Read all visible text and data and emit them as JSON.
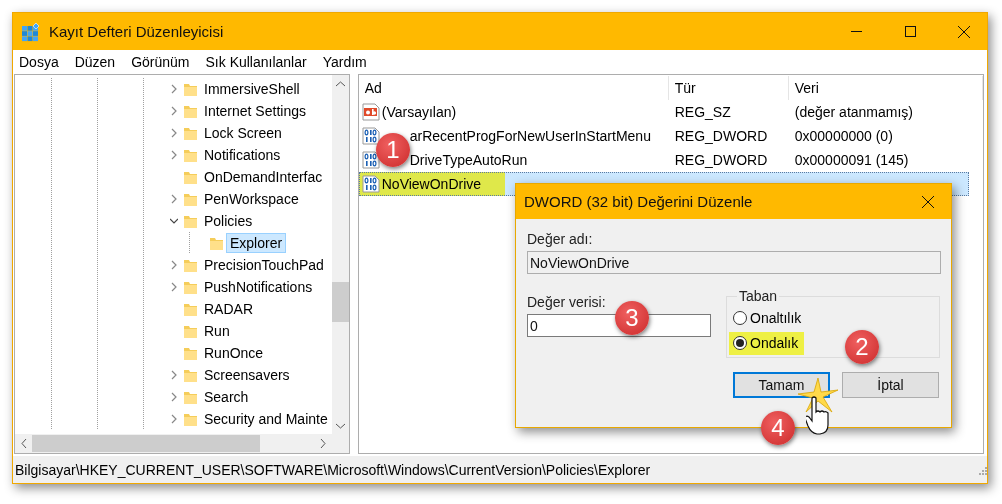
{
  "window": {
    "title": "Kayıt Defteri Düzenleyicisi"
  },
  "menu": [
    "Dosya",
    "Düzen",
    "Görünüm",
    "Sık Kullanılanlar",
    "Yardım"
  ],
  "tree": {
    "items": [
      {
        "label": "ImmersiveShell",
        "expandable": true,
        "expanded": false,
        "selected": false
      },
      {
        "label": "Internet Settings",
        "expandable": true,
        "expanded": false,
        "selected": false
      },
      {
        "label": "Lock Screen",
        "expandable": true,
        "expanded": false,
        "selected": false
      },
      {
        "label": "Notifications",
        "expandable": true,
        "expanded": false,
        "selected": false
      },
      {
        "label": "OnDemandInterfac",
        "expandable": false,
        "selected": false
      },
      {
        "label": "PenWorkspace",
        "expandable": true,
        "expanded": false,
        "selected": false
      },
      {
        "label": "Policies",
        "expandable": true,
        "expanded": true,
        "selected": false,
        "children": [
          {
            "label": "Explorer",
            "expandable": false,
            "selected": true
          }
        ]
      },
      {
        "label": "PrecisionTouchPad",
        "expandable": true,
        "expanded": false,
        "selected": false
      },
      {
        "label": "PushNotifications",
        "expandable": true,
        "expanded": false,
        "selected": false
      },
      {
        "label": "RADAR",
        "expandable": false,
        "selected": false
      },
      {
        "label": "Run",
        "expandable": false,
        "selected": false
      },
      {
        "label": "RunOnce",
        "expandable": false,
        "selected": false
      },
      {
        "label": "Screensavers",
        "expandable": true,
        "expanded": false,
        "selected": false
      },
      {
        "label": "Search",
        "expandable": true,
        "expanded": false,
        "selected": false
      },
      {
        "label": "Security and Mainte",
        "expandable": true,
        "expanded": false,
        "selected": false
      }
    ]
  },
  "values": {
    "columns": [
      "Ad",
      "Tür",
      "Veri"
    ],
    "rows": [
      {
        "kind": "string",
        "name": "(Varsayılan)",
        "type": "REG_SZ",
        "data": "(değer atanmamış)",
        "selected": false,
        "highlighted": false
      },
      {
        "kind": "dword",
        "name": "arRecentProgForNewUserInStartMenu",
        "type": "REG_DWORD",
        "data": "0x00000000 (0)",
        "selected": false,
        "highlighted": false,
        "overlapped": true
      },
      {
        "kind": "dword",
        "name": "DriveTypeAutoRun",
        "type": "REG_DWORD",
        "data": "0x00000091 (145)",
        "selected": false,
        "highlighted": false,
        "overlapped": true
      },
      {
        "kind": "dword",
        "name": "NoViewOnDrive",
        "selected": true,
        "highlighted": true
      }
    ]
  },
  "status_bar": "Bilgisayar\\HKEY_CURRENT_USER\\SOFTWARE\\Microsoft\\Windows\\CurrentVersion\\Policies\\Explorer",
  "dialog": {
    "title": "DWORD (32 bit) Değerini Düzenle",
    "name_label": "Değer adı:",
    "name_value": "NoViewOnDrive",
    "data_label": "Değer verisi:",
    "data_value": "0",
    "base": {
      "label": "Taban",
      "options": [
        {
          "label": "Onaltılık",
          "selected": false,
          "highlighted": false
        },
        {
          "label": "Ondalık",
          "selected": true,
          "highlighted": true
        }
      ]
    },
    "buttons": [
      {
        "label": "Tamam",
        "default": true
      },
      {
        "label": "İptal",
        "default": false
      }
    ]
  },
  "markers": [
    "1",
    "2",
    "3",
    "4"
  ]
}
